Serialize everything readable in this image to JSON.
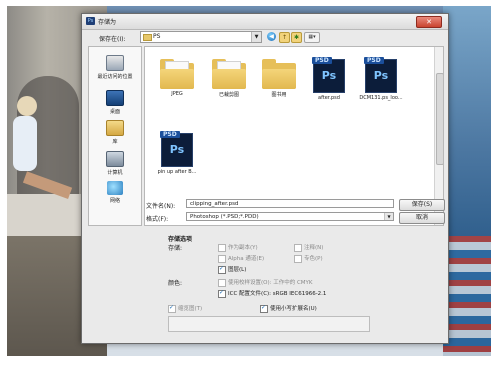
{
  "dialog": {
    "title": "存储为",
    "app_icon": "Ps"
  },
  "location": {
    "label": "保存在(I):",
    "value": "PS",
    "back_glyph": "◀",
    "up_glyph": "↑",
    "new_glyph": "✱",
    "view_glyph": "▦▾"
  },
  "sidebar": {
    "items": [
      {
        "label": "最近访问的位置",
        "icon": "recent-places-icon"
      },
      {
        "label": "桌面",
        "icon": "desktop-icon"
      },
      {
        "label": "库",
        "icon": "library-icon"
      },
      {
        "label": "计算机",
        "icon": "computer-icon"
      },
      {
        "label": "网络",
        "icon": "network-icon"
      }
    ]
  },
  "files": [
    {
      "label": "JPEG",
      "type": "folder"
    },
    {
      "label": "已裁剪图",
      "type": "folder"
    },
    {
      "label": "图书用",
      "type": "folder"
    },
    {
      "label": "after.psd",
      "type": "psd"
    },
    {
      "label": "DCM131.ps_loo...",
      "type": "psd"
    },
    {
      "label": "pin up after B...",
      "type": "psd"
    }
  ],
  "psd_badge": "PSD",
  "psd_mark": "Ps",
  "filename": {
    "label": "文件名(N):",
    "value": "clipping_after.psd"
  },
  "filetype": {
    "label": "格式(F):",
    "value": "Photoshop (*.PSD;*.PDD)"
  },
  "buttons": {
    "save": "保存(S)",
    "cancel": "取消"
  },
  "options": {
    "title": "存储选项",
    "storage_label": "存储:",
    "as_copy": "作为副本(Y)",
    "notes": "注释(N)",
    "alpha": "Alpha 通道(E)",
    "spot": "专色(P)",
    "layers": "图层(L)",
    "color_label": "颜色:",
    "proof": "使用校样设置(O): 工作中的 CMYK",
    "icc": "ICC 配置文件(C): sRGB IEC61966-2.1",
    "thumbnail": "缩览图(T)",
    "lowercase": "使用小写扩展名(U)"
  }
}
